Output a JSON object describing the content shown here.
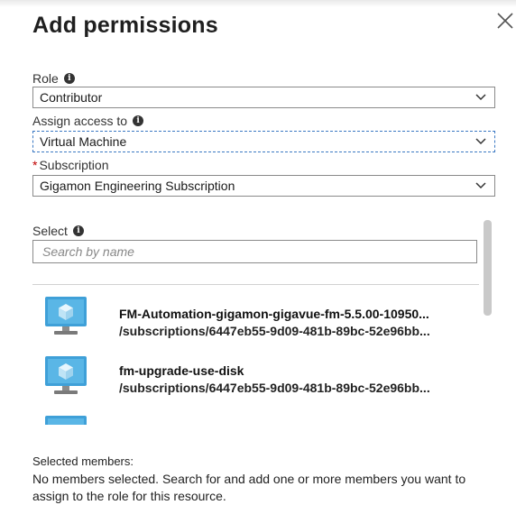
{
  "panel": {
    "title": "Add permissions"
  },
  "role": {
    "label": "Role",
    "value": "Contributor"
  },
  "assign": {
    "label": "Assign access to",
    "value": "Virtual Machine"
  },
  "subscription": {
    "required_mark": "*",
    "label": "Subscription",
    "value": "Gigamon Engineering Subscription"
  },
  "select": {
    "label": "Select",
    "placeholder": "Search by name"
  },
  "results": [
    {
      "name": "FM-Automation-gigamon-gigavue-fm-5.5.00-10950...",
      "path": "/subscriptions/6447eb55-9d09-481b-89bc-52e96bb..."
    },
    {
      "name": "fm-upgrade-use-disk",
      "path": "/subscriptions/6447eb55-9d09-481b-89bc-52e96bb..."
    },
    {
      "name": "",
      "path": ""
    }
  ],
  "selected_members": {
    "title": "Selected members:",
    "description": "No members selected. Search for and add one or more members you want to assign to the role for this resource."
  },
  "colors": {
    "focus_border": "#3a78c3",
    "required": "#c00000",
    "vm_blue": "#3fa0d8"
  },
  "icons": {
    "close": "close-icon",
    "info": "info-icon",
    "dropdown": "chevron-down-icon",
    "resource": "virtual-machine-icon"
  }
}
